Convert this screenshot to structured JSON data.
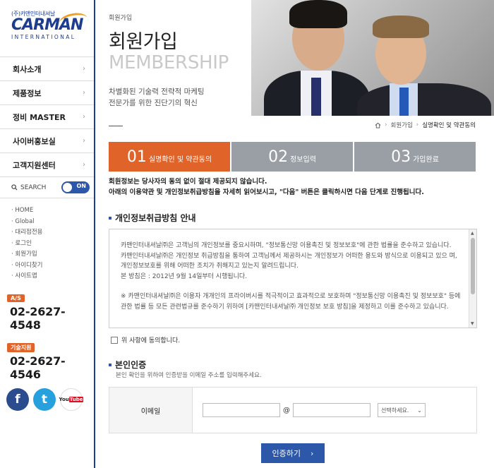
{
  "logo": {
    "small": "(주)카맨인터내셔날",
    "main": "CARMAN",
    "sub": "INTERNATIONAL"
  },
  "menu": [
    {
      "label": "회사소개"
    },
    {
      "label": "제품정보"
    },
    {
      "label": "정비 MASTER"
    },
    {
      "label": "사이버홍보실"
    },
    {
      "label": "고객지원센터"
    }
  ],
  "search": {
    "label": "SEARCH",
    "toggle": "ON"
  },
  "sublinks": [
    "HOME",
    "Global",
    "대리점전용",
    "로그인",
    "회원가입",
    "아이디찾기",
    "사이트맵"
  ],
  "contacts": [
    {
      "badge": "A/S",
      "number": "02-2627-4548"
    },
    {
      "badge": "기술지원",
      "number": "02-2627-4546"
    }
  ],
  "social": {
    "facebook": "f",
    "twitter": "t",
    "youtube_you": "You",
    "youtube_tube": "Tube"
  },
  "hero": {
    "crumb": "회원가입",
    "title_ko": "회원가입",
    "title_en": "MEMBERSHIP",
    "subtitle_1": "차별화된 기술력 전략적 마케팅",
    "subtitle_2": "전문가를 위한 진단기의 혁신"
  },
  "breadcrumb": {
    "level1": "회원가입",
    "current": "실명확인 및 약관동의"
  },
  "steps": [
    {
      "num": "01",
      "label": "실명확인 및 약관동의",
      "active": true
    },
    {
      "num": "02",
      "label": "정보입력",
      "active": false
    },
    {
      "num": "03",
      "label": "가입완료",
      "active": false
    }
  ],
  "intro": {
    "line1": "회원정보는 당사자의 동의 없이 절대 제공되지 않습니다.",
    "line2": "아래의 이용약관 및 개인정보취급방침을 자세히 읽어보시고, \"다음\" 버튼은 클릭하시면 다음 단계로 진행됩니다."
  },
  "privacy": {
    "title": "개인정보취급방침 안내",
    "paragraphs": [
      "카맨인터내셔날㈜은 고객님의 개인정보를 중요시하며, \"정보통신망 이용촉진 및 정보보호\"에 관한 법률을 준수하고 있습니다.",
      "카맨인터내셔날㈜은 개인정보 취급방침을 통하여 고객님께서 제공하시는 개인정보가 어떠한 용도와 방식으로 이용되고 있으 며, 개인정보보호를 위해 어떠한 조치가 취해지고 있는지 알려드립니다.",
      "본 방침은 : 2012년 9월 14일부터 시행됩니다.",
      "※ 카맨인터내셔날㈜은 이용자 개개인의 프라이버시를 적극적이고 효과적으로 보호하며 \"정보통신망 이용촉진 및 정보보호\" 등에 관한 법률 등 모든 관련법규를 준수하기 위하여 [카맨인터내셔날㈜ 개인정보 보호 방침]을 제정하고 이를 준수하고 있습니다."
    ],
    "agree_label": "위 사항에 동의합니다."
  },
  "verify": {
    "title": "본인인증",
    "description": "본인 확인을 위하여 인증받을 이메일 주소를 입력해주세요.",
    "email_label": "이메일",
    "at": "@",
    "select_placeholder": "선택하세요.",
    "submit_label": "인증하기"
  },
  "colors": {
    "brand_blue": "#2d57a8",
    "accent_orange": "#e0642a",
    "step_gray": "#9a9fa5"
  }
}
